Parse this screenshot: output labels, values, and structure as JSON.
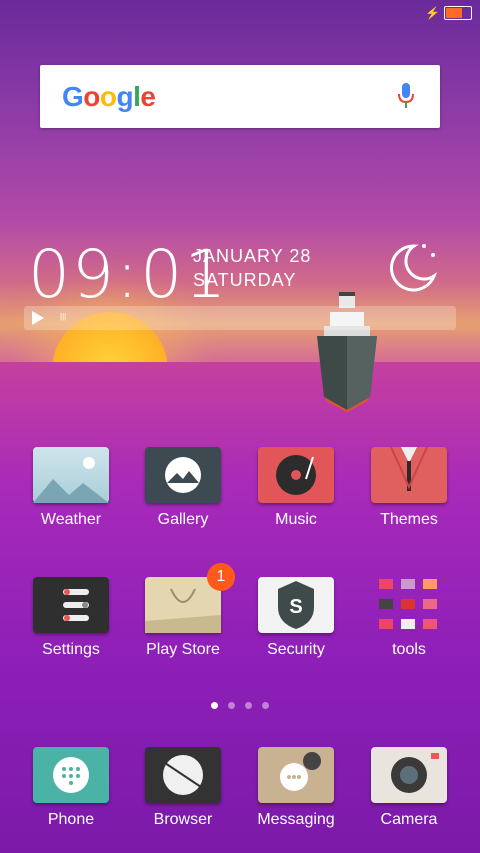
{
  "status": {
    "charging_icon": "bolt-icon",
    "battery_level": 0.6
  },
  "search": {
    "logo": "Google",
    "mic_icon": "mic-icon"
  },
  "clock": {
    "time": "09:01",
    "date_line1": "JANUARY 28",
    "date_line2": "SATURDAY",
    "weather_icon": "moon-icon"
  },
  "music": {
    "play_icon": "play-icon"
  },
  "apps_row1": [
    {
      "label": "Weather",
      "icon": "weather-icon"
    },
    {
      "label": "Gallery",
      "icon": "gallery-icon"
    },
    {
      "label": "Music",
      "icon": "music-icon"
    },
    {
      "label": "Themes",
      "icon": "themes-icon"
    }
  ],
  "apps_row2": [
    {
      "label": "Settings",
      "icon": "settings-icon"
    },
    {
      "label": "Play Store",
      "icon": "play-store-icon",
      "badge": "1"
    },
    {
      "label": "Security",
      "icon": "security-icon"
    },
    {
      "label": "tools",
      "icon": "tools-folder-icon"
    }
  ],
  "pager": {
    "pages": 4,
    "active": 1
  },
  "dock": [
    {
      "label": "Phone",
      "icon": "phone-icon"
    },
    {
      "label": "Browser",
      "icon": "browser-icon"
    },
    {
      "label": "Messaging",
      "icon": "messaging-icon"
    },
    {
      "label": "Camera",
      "icon": "camera-icon"
    }
  ]
}
